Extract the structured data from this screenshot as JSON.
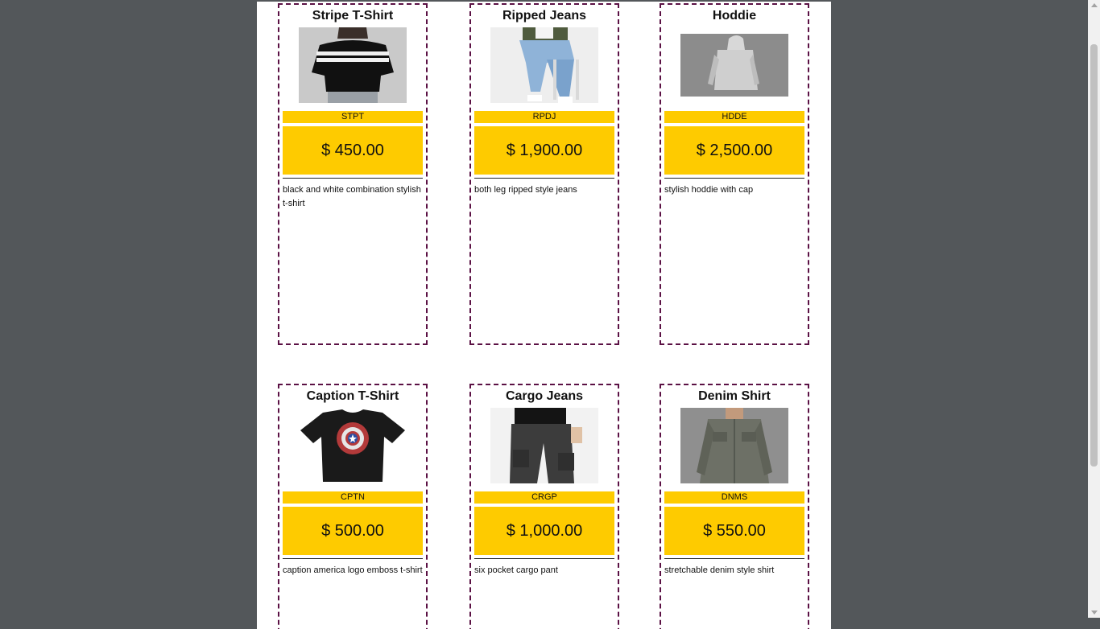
{
  "products": [
    {
      "name": "Stripe T-Shirt",
      "image": "stripe-tshirt-photo",
      "code": "STPT",
      "price": "$ 450.00",
      "description": "black and white combination stylish t-shirt"
    },
    {
      "name": "Ripped Jeans",
      "image": "ripped-jeans-photo",
      "code": "RPDJ",
      "price": "$ 1,900.00",
      "description": "both leg ripped style jeans"
    },
    {
      "name": "Hoddie",
      "image": "hoodie-photo",
      "code": "HDDE",
      "price": "$ 2,500.00",
      "description": "stylish hoddie with cap"
    },
    {
      "name": "Caption T-Shirt",
      "image": "captain-america-tshirt-photo",
      "code": "CPTN",
      "price": "$ 500.00",
      "description": "caption america logo emboss t-shirt"
    },
    {
      "name": "Cargo Jeans",
      "image": "cargo-pants-photo",
      "code": "CRGP",
      "price": "$ 1,000.00",
      "description": "six pocket cargo pant"
    },
    {
      "name": "Denim Shirt",
      "image": "denim-shirt-photo",
      "code": "DNMS",
      "price": "$ 550.00",
      "description": "stretchable denim style shirt"
    }
  ],
  "colors": {
    "accent": "#fecb00",
    "card_border": "#5b1144",
    "backdrop": "#53575a"
  }
}
